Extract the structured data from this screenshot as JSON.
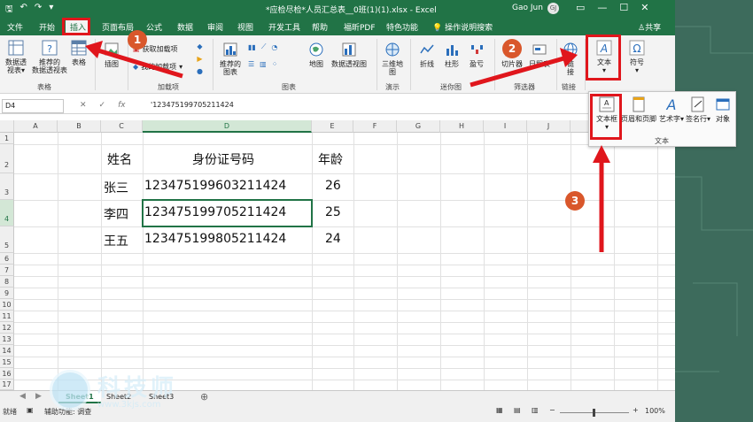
{
  "titlebar": {
    "title": "*应检尽检*人员汇总表__0班(1)(1).xlsx  -  Excel",
    "user": "Gao Jun",
    "avatar": "GJ"
  },
  "tabs": [
    {
      "label": "文件"
    },
    {
      "label": "开始"
    },
    {
      "label": "插入"
    },
    {
      "label": "页面布局"
    },
    {
      "label": "公式"
    },
    {
      "label": "数据"
    },
    {
      "label": "审阅"
    },
    {
      "label": "视图"
    },
    {
      "label": "开发工具"
    },
    {
      "label": "帮助"
    },
    {
      "label": "福昕PDF"
    },
    {
      "label": "特色功能"
    }
  ],
  "help_search": "操作说明搜索",
  "share": "共享",
  "ribbon": {
    "pivot": "数据透\n视表▾",
    "rec_pivot": "推荐的\n数据透视表",
    "table": "表格",
    "group_tables": "表格",
    "illustrations": "插图",
    "get_addins": "获取加载项",
    "my_addins": "我的加载项",
    "group_addins": "加载项",
    "rec_charts": "推荐的\n图表",
    "maps": "地图",
    "pivot_chart": "数据透视图",
    "group_charts": "图表",
    "map3d": "三维地\n图",
    "group_tours": "演示",
    "spark_line": "折线",
    "spark_column": "柱形",
    "spark_winloss": "盈亏",
    "group_sparklines": "迷你图",
    "slicer": "切片器",
    "timeline": "日程表",
    "group_filters": "筛选器",
    "link": "链\n接",
    "group_links": "链接",
    "text": "文本",
    "symbols": "符号"
  },
  "formula_bar": {
    "name_box": "D4",
    "fx": "fx",
    "value": "'123475199705211424"
  },
  "columns": [
    "A",
    "B",
    "C",
    "D",
    "E",
    "F",
    "G",
    "H",
    "I",
    "J"
  ],
  "rows": [
    "1",
    "2",
    "3",
    "4",
    "5",
    "6",
    "7",
    "8",
    "9",
    "10",
    "11",
    "12",
    "13",
    "14",
    "15",
    "16",
    "17"
  ],
  "table": {
    "headers": [
      "姓名",
      "身份证号码",
      "年龄"
    ],
    "rows": [
      [
        "张三",
        "123475199603211424",
        "26"
      ],
      [
        "李四",
        "123475199705211424",
        "25"
      ],
      [
        "王五",
        "123475199805211424",
        "24"
      ]
    ]
  },
  "text_panel": {
    "textbox": "文本框",
    "header_footer": "页眉和页脚",
    "wordart": "艺术字",
    "signature": "签名行",
    "object": "对象",
    "group": "文本"
  },
  "sheets": [
    "Sheet1",
    "Sheet2",
    "Sheet3"
  ],
  "status": {
    "ready": "就绪",
    "accessibility": "辅助功能: 调查",
    "zoom": "100%"
  },
  "badges": [
    "1",
    "2",
    "3"
  ],
  "watermark": {
    "name": "科技师",
    "url": "www.3kjs.com"
  },
  "colors": {
    "excel_green": "#217346",
    "annotation_red": "#e0161c",
    "badge_orange": "#d9572b"
  }
}
